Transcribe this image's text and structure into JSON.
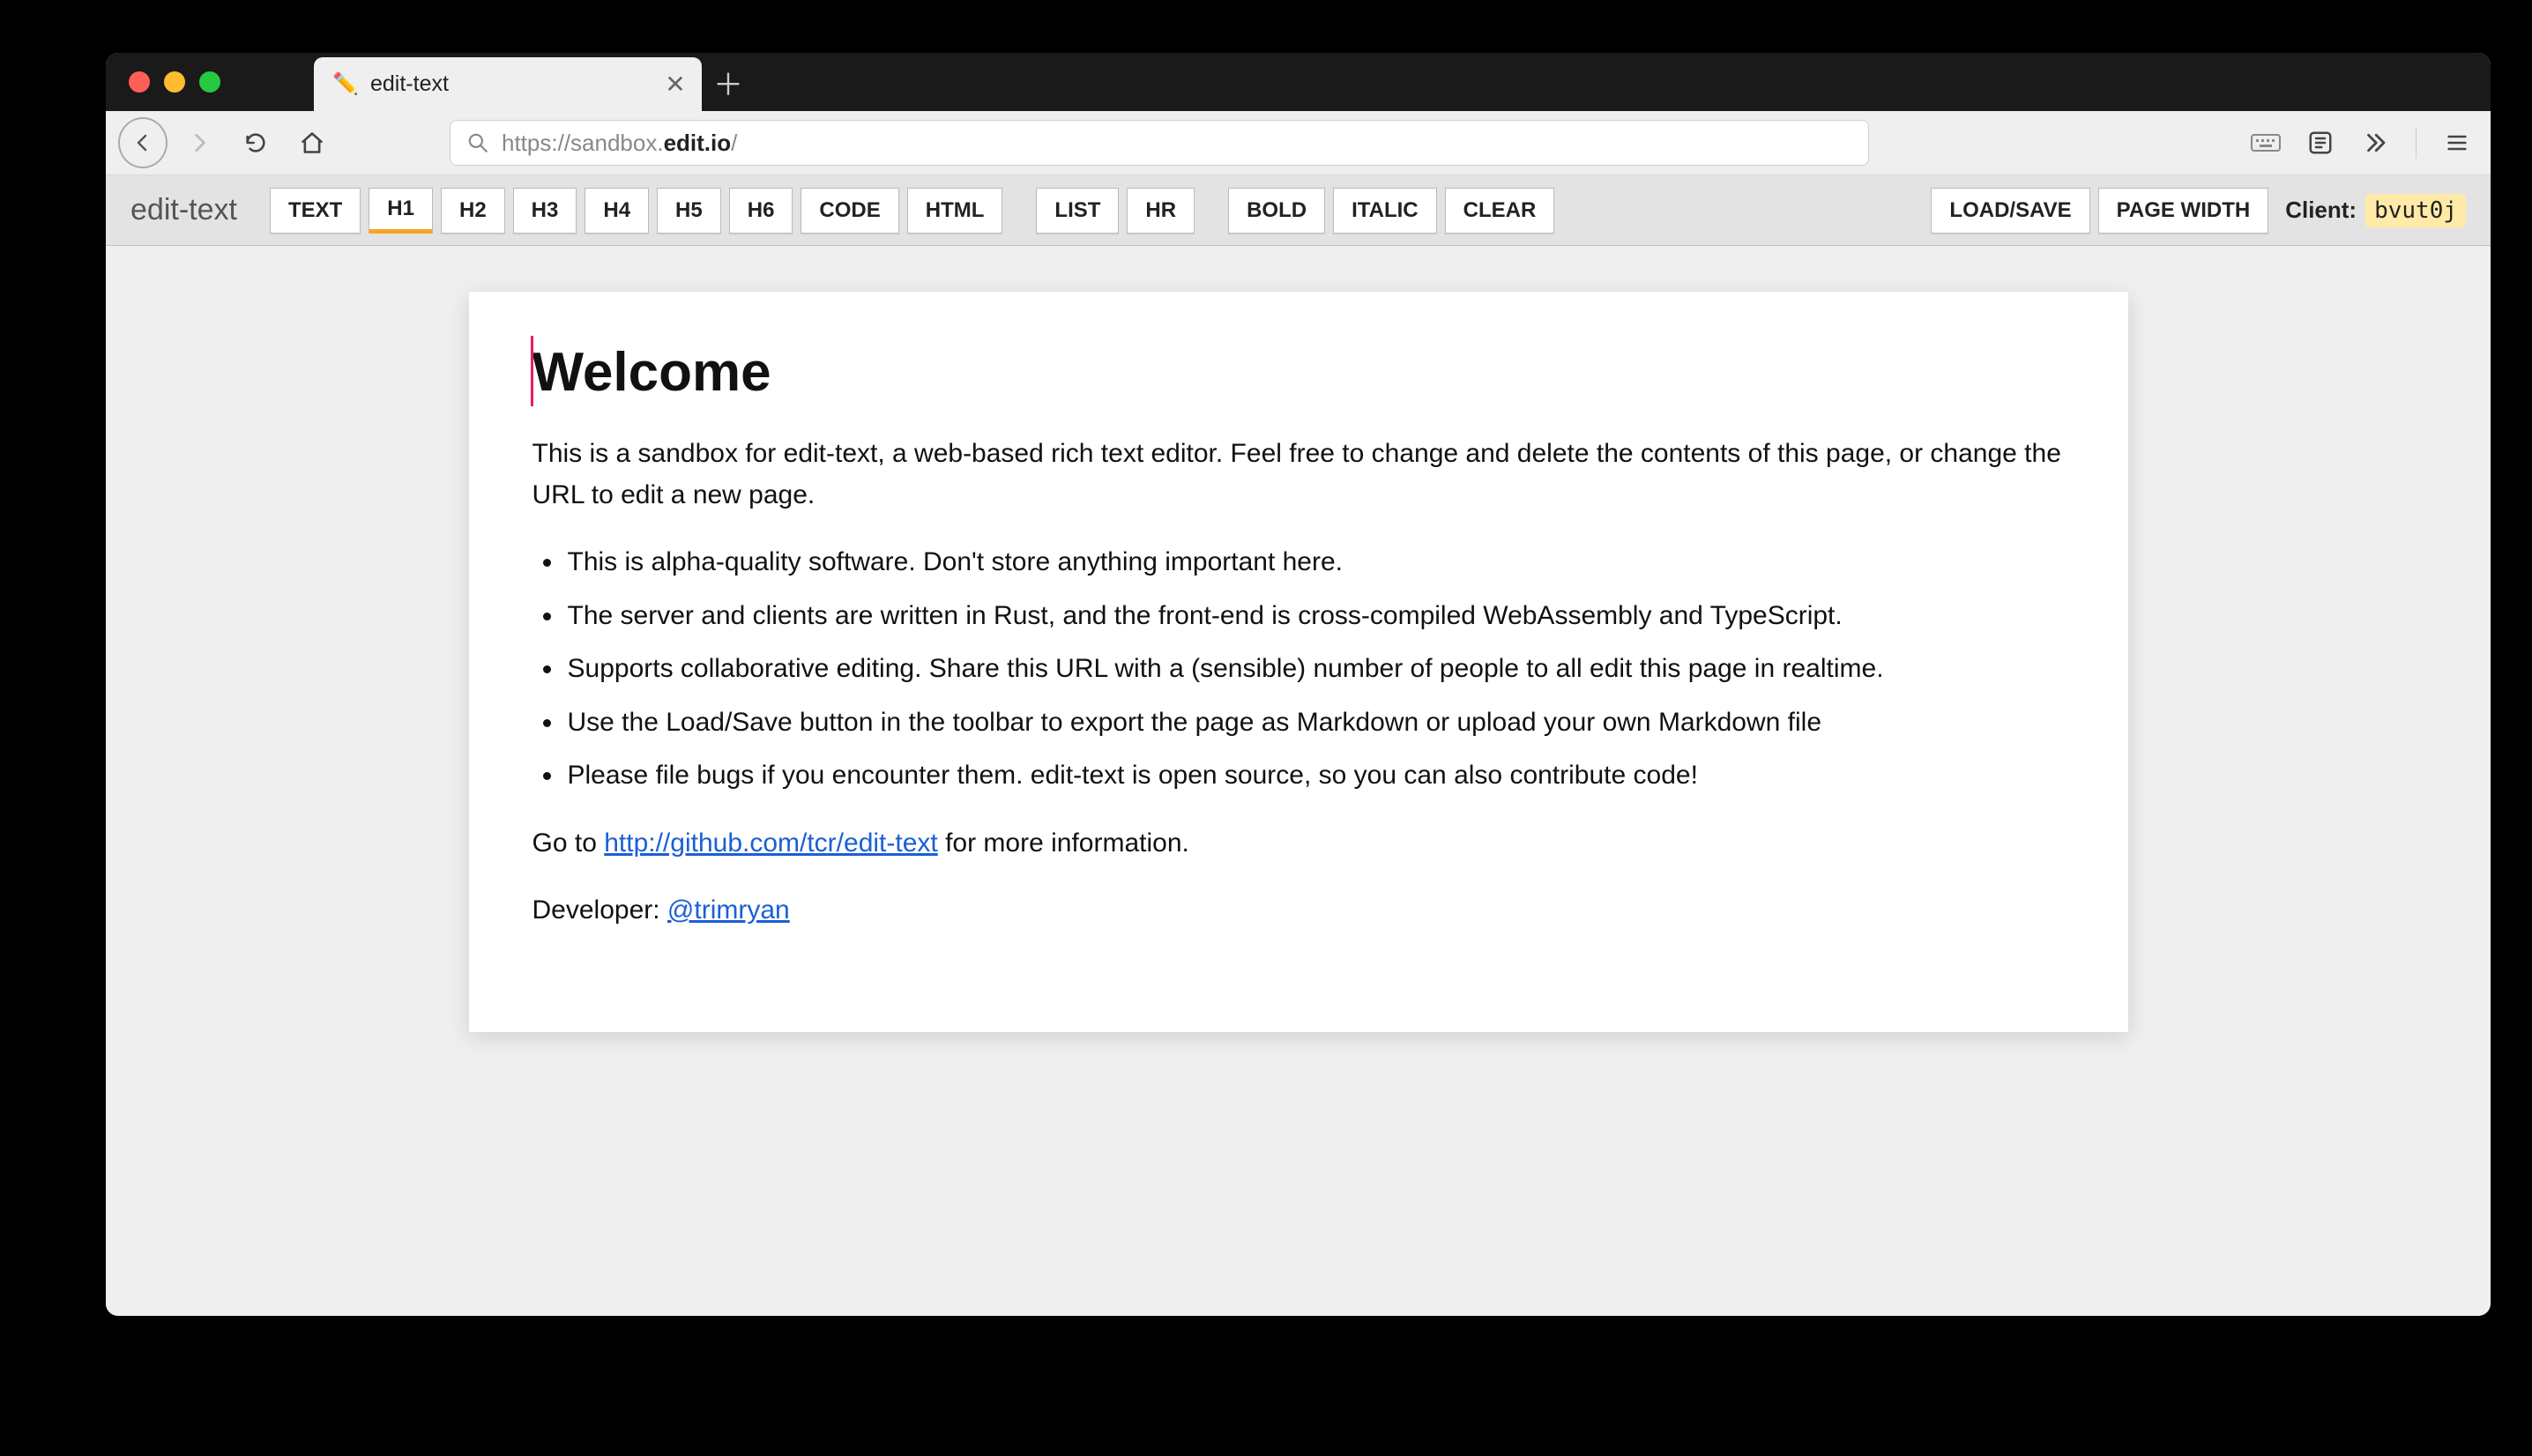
{
  "browser": {
    "tab_title": "edit-text",
    "url_plain_prefix": "https://sandbox.",
    "url_bold": "edit.io",
    "url_plain_suffix": "/"
  },
  "toolbar": {
    "app_name": "edit-text",
    "buttons_group1": [
      "TEXT",
      "H1",
      "H2",
      "H3",
      "H4",
      "H5",
      "H6",
      "CODE",
      "HTML"
    ],
    "active_index": 1,
    "buttons_group2": [
      "LIST",
      "HR"
    ],
    "buttons_group3": [
      "BOLD",
      "ITALIC",
      "CLEAR"
    ],
    "buttons_group4": [
      "LOAD/SAVE",
      "PAGE WIDTH"
    ],
    "client_label": "Client:",
    "client_id": "bvut0j"
  },
  "document": {
    "heading": "Welcome",
    "intro": "This is a sandbox for edit-text, a web-based rich text editor. Feel free to change and delete the contents of this page, or change the URL to edit a new page.",
    "bullets": [
      "This is alpha-quality software. Don't store anything important here.",
      "The server and clients are written in Rust, and the front-end is cross-compiled WebAssembly and TypeScript.",
      "Supports collaborative editing. Share this URL with a (sensible) number of people to all edit this page in realtime.",
      "Use the Load/Save button in the toolbar to export the page as Markdown or upload your own Markdown file",
      "Please file bugs if you encounter them. edit-text is open source, so you can also contribute code!"
    ],
    "link_line_prefix": "Go to ",
    "link_text": "http://github.com/tcr/edit-text",
    "link_line_suffix": " for more information.",
    "dev_prefix": "Developer: ",
    "dev_handle": "@trimryan"
  }
}
